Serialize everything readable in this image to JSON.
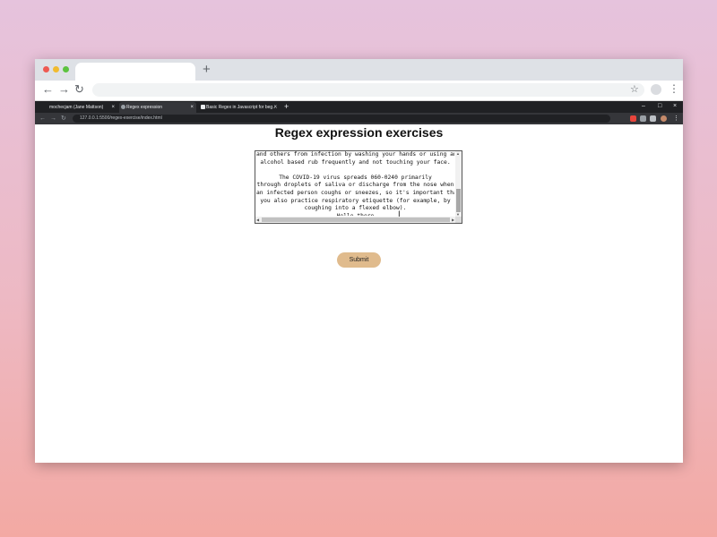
{
  "outer_browser": {
    "new_tab_symbol": "+",
    "back_symbol": "←",
    "forward_symbol": "→",
    "reload_symbol": "↻",
    "star_symbol": "☆",
    "menu_symbol": "⋮"
  },
  "inner_browser": {
    "tabs": [
      {
        "label": "mochecjam (Jane Mattson)",
        "close": "×"
      },
      {
        "label": "Regex expression",
        "close": "×"
      },
      {
        "label": "Basic Regex in Javascript for beg…",
        "close": "×"
      }
    ],
    "new_tab_symbol": "+",
    "window_controls": [
      "–",
      "□",
      "×"
    ],
    "address": "127.0.0.1:5500/regex-exercise/index.html",
    "nav": [
      "←",
      "→",
      "↻"
    ],
    "menu_symbol": "⋮"
  },
  "page": {
    "title": "Regex expression exercises",
    "textarea_text": "and others from infection by washing your hands or using an\nalcohol based rub frequently and not touching your face.\n\nThe COVID-19 virus spreads 060-0240 primarily\nthrough droplets of saliva or discharge from the nose when\nan infected person coughs or sneezes, so it's important that\nyou also practice respiratory etiquette (for example, by\ncoughing into a flexed elbow).\nHello there",
    "submit_label": "Submit"
  },
  "icons": {
    "scroll_up": "▲",
    "scroll_down": "▼",
    "scroll_left": "◀",
    "scroll_right": "▶",
    "text_cursor": "I"
  },
  "colors": {
    "submit_button": "#e0bb8d",
    "inner_tabstrip": "#202124",
    "inner_toolbar": "#35363a"
  }
}
